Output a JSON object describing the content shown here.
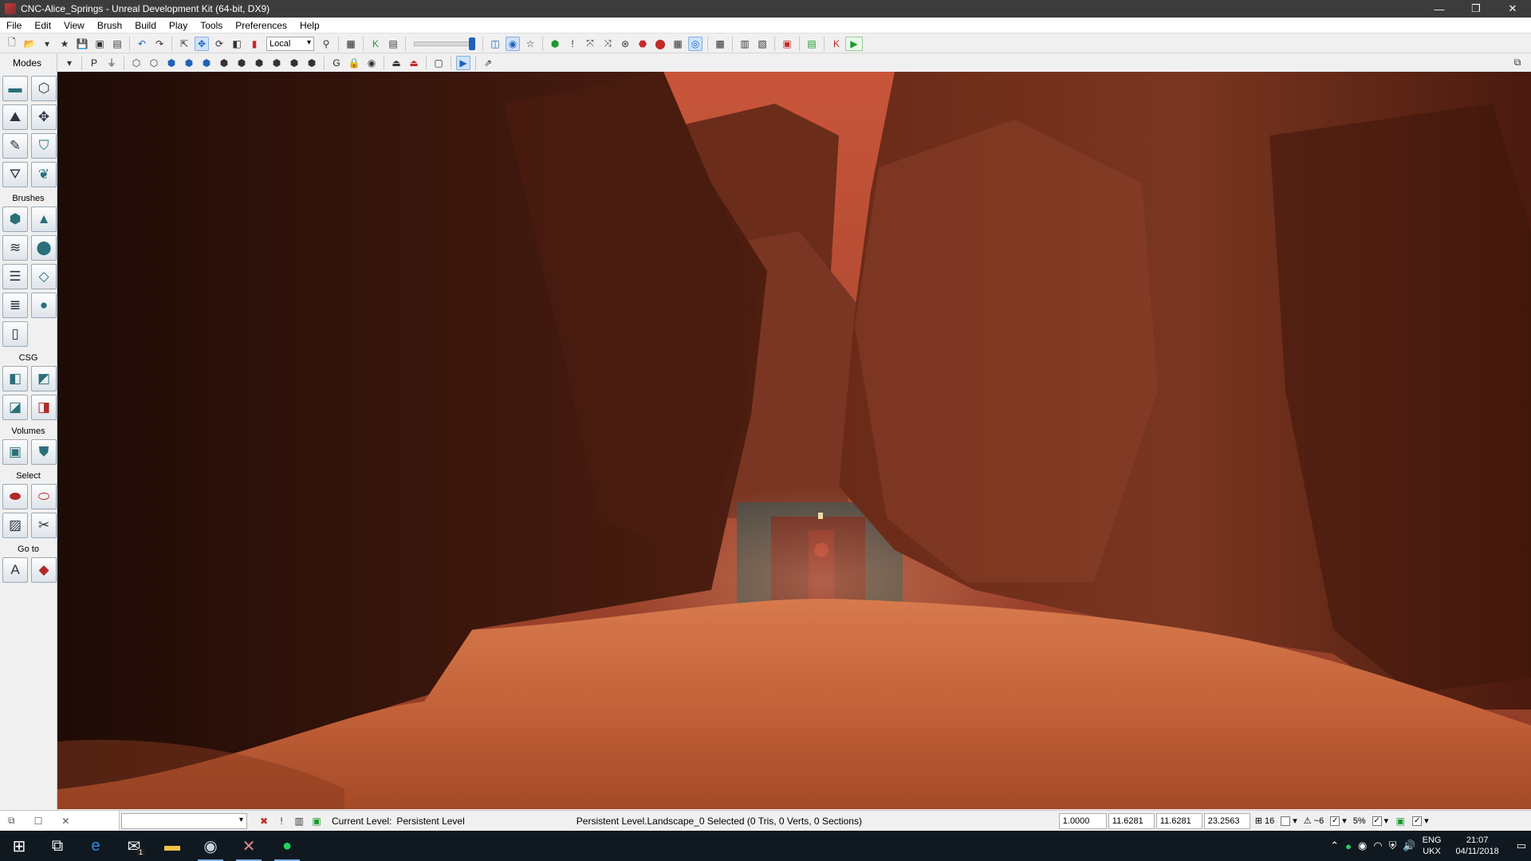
{
  "window": {
    "title": "CNC-Alice_Springs - Unreal Development Kit (64-bit, DX9)",
    "minimize": "—",
    "restore": "❐",
    "close": "✕"
  },
  "menu": [
    "File",
    "Edit",
    "View",
    "Brush",
    "Build",
    "Play",
    "Tools",
    "Preferences",
    "Help"
  ],
  "toolbar": {
    "coord_system": "Local"
  },
  "modes": {
    "title": "Modes",
    "sections": {
      "brushes": "Brushes",
      "csg": "CSG",
      "volumes": "Volumes",
      "select": "Select",
      "goto": "Go to"
    }
  },
  "status": {
    "current_level_label": "Current Level:",
    "current_level_value": "Persistent Level",
    "selection": "Persistent Level.Landscape_0 Selected (0 Tris, 0 Verts, 0 Sections)",
    "drag_grid_scale": "1.0000",
    "readout_x": "11.6281",
    "readout_y": "11.6281",
    "readout_z": "23.2563",
    "grid_size": "16",
    "rotation_snap": "~6",
    "scale_snap": "5%"
  },
  "taskbar": {
    "lang_top": "ENG",
    "lang_bottom": "UKX",
    "time": "21:07",
    "date": "04/11/2018",
    "mail_badge": "1"
  },
  "colors": {
    "title_bg": "#3c3c3c",
    "taskbar_bg": "#101820",
    "accent_blue": "#1e63b8",
    "play_green": "#1a9a2a",
    "rock": "#5a2314",
    "sand": "#c4623a"
  }
}
